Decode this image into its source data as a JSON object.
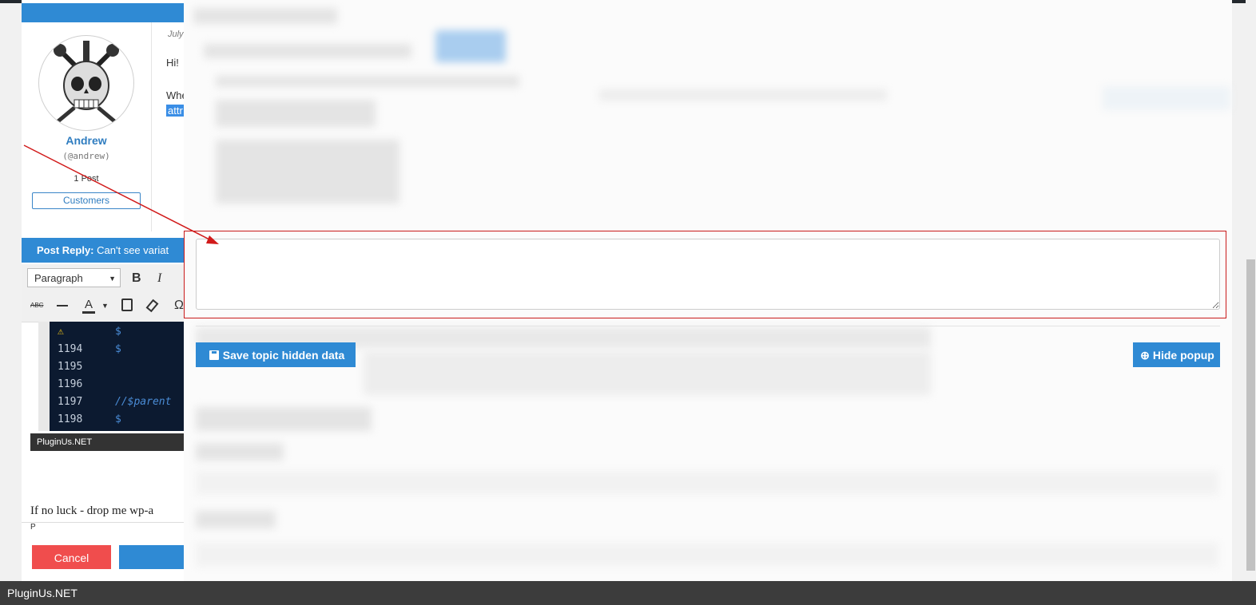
{
  "post": {
    "date": "July",
    "greeting": "Hi!",
    "body_start": "Whe",
    "highlight_fragment": "attr"
  },
  "author": {
    "name": "Andrew",
    "handle": "(@andrew)",
    "posts": "1 Post",
    "role": "Customers"
  },
  "reply": {
    "header_label": "Post Reply:",
    "header_title": "Can't see variat",
    "format_value": "Paragraph",
    "toolbar_icons": [
      "bold-icon",
      "italic-icon",
      "strikethrough-icon",
      "horizontal-line-icon",
      "text-color-icon",
      "paste-text-icon",
      "clear-formatting-icon",
      "special-character-icon"
    ],
    "code_lines": [
      {
        "num": "",
        "code": "$"
      },
      {
        "num": "1194",
        "code": "$"
      },
      {
        "num": "1195",
        "code": ""
      },
      {
        "num": "1196",
        "code": ""
      },
      {
        "num": "1197",
        "code": "//$parent"
      },
      {
        "num": "1198",
        "code": "$"
      }
    ],
    "image_watermark": "PluginUs.NET",
    "editor_text": "If  no luck   - drop me wp-a",
    "editor_path": "P",
    "cancel_label": "Cancel",
    "submit_label": ""
  },
  "popup": {
    "textarea_value": "",
    "save_button_label": "Save topic hidden data",
    "hide_button_label": "Hide popup"
  },
  "footer": {
    "watermark": "PluginUs.NET"
  },
  "colors": {
    "primary": "#2f8ad4",
    "danger": "#f04d4d",
    "highlight_border": "#c91a1a",
    "annotation_arrow": "#d11a1a"
  }
}
